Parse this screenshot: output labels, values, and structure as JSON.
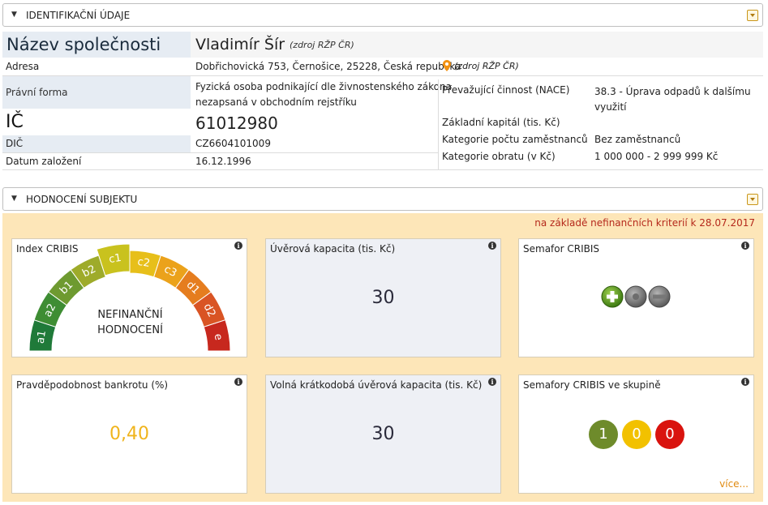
{
  "ident": {
    "title": "IDENTIFIKAČNÍ ÚDAJE",
    "company_label": "Název společnosti",
    "company_name": "Vladimír Šír",
    "company_source": "(zdroj RŽP ČR)",
    "address_label": "Adresa",
    "address_value": "Dobřichovická 753, Černošice, 25228, Česká republika",
    "address_source": "(zdroj RŽP ČR)",
    "legal_form_label": "Právní forma",
    "legal_form_line1": "Fyzická osoba podnikající dle živnostenského zákona",
    "legal_form_line2": "nezapsaná v obchodním rejstříku",
    "ic_label": "IČ",
    "ic_value": "61012980",
    "dic_label": "DIČ",
    "dic_value": "CZ6604101009",
    "founded_label": "Datum založení",
    "founded_value": "16.12.1996",
    "nace_label": "Převažující činnost (NACE)",
    "nace_line1": "38.3 - Úprava odpadů k dalšímu",
    "nace_line2": "využití",
    "capital_label": "Základní kapitál (tis. Kč)",
    "employees_label": "Kategorie počtu zaměstnanců",
    "employees_value": "Bez zaměstnanců",
    "turnover_label": "Kategorie obratu (v Kč)",
    "turnover_value": "1 000 000 - 2 999 999 Kč"
  },
  "rating": {
    "title": "HODNOCENÍ SUBJEKTU",
    "note": "na základě nefinančních kriterií k 28.07.2017",
    "index_title": "Index CRIBIS",
    "gauge_text_line1": "NEFINANČNÍ",
    "gauge_text_line2": "HODNOCENÍ",
    "gauge_labels": [
      "a1",
      "a2",
      "b1",
      "b2",
      "c1",
      "c2",
      "c3",
      "d1",
      "d2",
      "e"
    ],
    "gauge_selected": "c1",
    "credit_title": "Úvěrová kapacita (tis. Kč)",
    "credit_value": "30",
    "semafor_title": "Semafor CRIBIS",
    "bankrupt_title": "Pravděpodobnost bankrotu (%)",
    "bankrupt_value": "0,40",
    "short_credit_title": "Volná krátkodobá úvěrová kapacita (tis. Kč)",
    "short_credit_value": "30",
    "group_title": "Semafory CRIBIS ve skupině",
    "group_green": "1",
    "group_yellow": "0",
    "group_red": "0",
    "more_link": "více...",
    "info_icon": "i"
  },
  "colors": {
    "accent_orange": "#fde6b8",
    "note_red": "#b5281b",
    "bankrupt_yellow": "#f0b41c",
    "green": "#6e8b2b",
    "yellow": "#f2c100",
    "red": "#d9130e"
  }
}
